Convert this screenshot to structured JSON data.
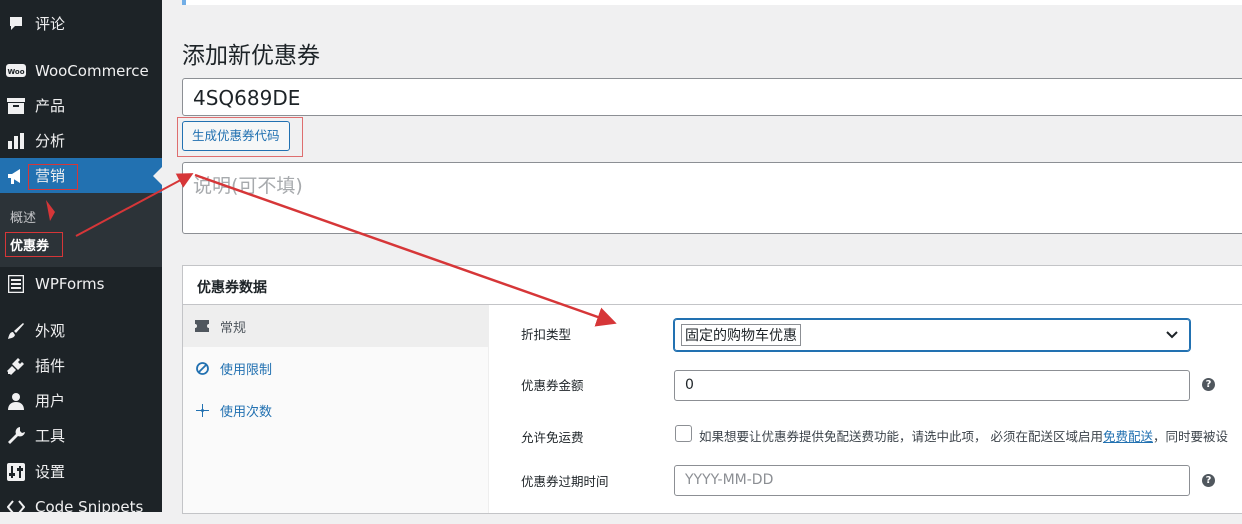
{
  "sidebar": {
    "items": [
      {
        "label": "评论",
        "icon": "comment-icon"
      },
      {
        "label": "WooCommerce",
        "icon": "woocommerce-icon"
      },
      {
        "label": "产品",
        "icon": "archive-icon"
      },
      {
        "label": "分析",
        "icon": "bar-chart-icon"
      },
      {
        "label": "营销",
        "icon": "megaphone-icon"
      },
      {
        "label": "WPForms",
        "icon": "forms-icon"
      },
      {
        "label": "外观",
        "icon": "paintbrush-icon"
      },
      {
        "label": "插件",
        "icon": "plugin-icon"
      },
      {
        "label": "用户",
        "icon": "user-icon"
      },
      {
        "label": "工具",
        "icon": "wrench-icon"
      },
      {
        "label": "设置",
        "icon": "settings-sliders-icon"
      },
      {
        "label": "Code Snippets",
        "icon": "code-icon"
      }
    ],
    "submenu": [
      {
        "label": "概述"
      },
      {
        "label": "优惠券"
      }
    ]
  },
  "page": {
    "title": "添加新优惠券",
    "coupon_code": "4SQ689DE",
    "generate_button": "生成优惠券代码",
    "description_placeholder": "说明(可不填)"
  },
  "coupon_data": {
    "title": "优惠券数据",
    "tabs": [
      {
        "label": "常规",
        "icon": "ticket-icon"
      },
      {
        "label": "使用限制",
        "icon": "block-icon"
      },
      {
        "label": "使用次数",
        "icon": "sparkle-icon"
      }
    ],
    "fields": {
      "discount_type_label": "折扣类型",
      "discount_type_value": "固定的购物车优惠",
      "amount_label": "优惠券金额",
      "amount_value": "0",
      "free_shipping_label": "允许免运费",
      "free_shipping_desc_before": "如果想要让优惠券提供免配送费功能，请选中此项， 必须在配送区域启用",
      "free_shipping_link": "免费配送",
      "free_shipping_desc_after": "，同时要被设",
      "expiry_label": "优惠券过期时间",
      "expiry_placeholder": "YYYY-MM-DD"
    }
  },
  "colors": {
    "sidebar_bg": "#1d2327",
    "active_blue": "#2271b1",
    "annotation_red": "#d63638"
  }
}
